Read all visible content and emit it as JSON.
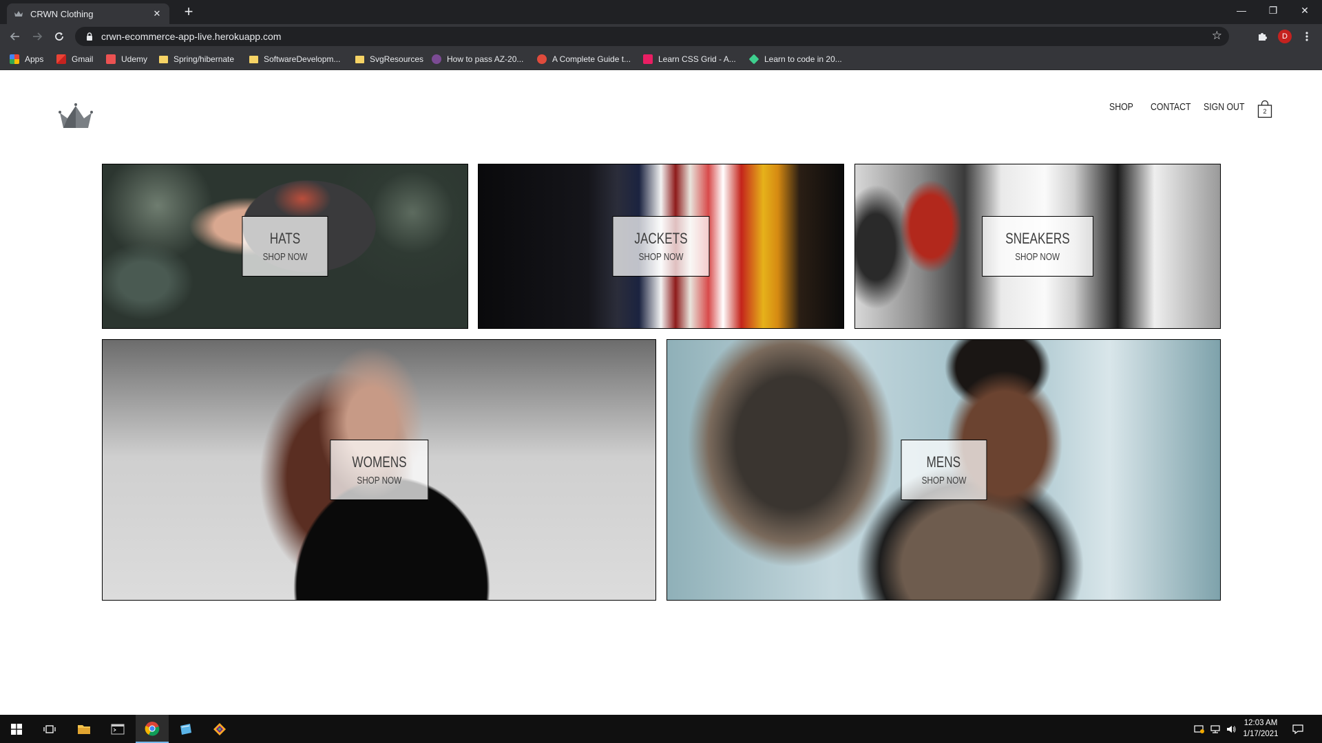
{
  "browser": {
    "tab_title": "CRWN Clothing",
    "tab_close": "✕",
    "new_tab": "+",
    "url": "crwn-ecommerce-app-live.herokuapp.com",
    "profile_initial": "D",
    "window_controls": {
      "minimize": "—",
      "restore": "❐",
      "close": "✕"
    },
    "bookmarks": [
      {
        "label": "Apps",
        "icon": "apps-grid-icon"
      },
      {
        "label": "Gmail",
        "icon": "gmail-icon"
      },
      {
        "label": "Udemy",
        "icon": "udemy-icon"
      },
      {
        "label": "Spring/hibernate",
        "icon": "folder-icon"
      },
      {
        "label": "SoftwareDevelopm...",
        "icon": "folder-icon"
      },
      {
        "label": "SvgResources",
        "icon": "folder-icon"
      },
      {
        "label": "How to pass AZ-20...",
        "icon": "site-icon"
      },
      {
        "label": "A Complete Guide t...",
        "icon": "site-icon"
      },
      {
        "label": "Learn CSS Grid - A...",
        "icon": "site-icon"
      },
      {
        "label": "Learn to code in 20...",
        "icon": "site-icon"
      }
    ]
  },
  "header": {
    "nav": {
      "shop": "SHOP",
      "contact": "CONTACT",
      "sign_out": "SIGN OUT"
    },
    "cart_count": "2"
  },
  "directory": [
    {
      "title": "HATS",
      "subtitle": "SHOP NOW"
    },
    {
      "title": "JACKETS",
      "subtitle": "SHOP NOW"
    },
    {
      "title": "SNEAKERS",
      "subtitle": "SHOP NOW"
    },
    {
      "title": "WOMENS",
      "subtitle": "SHOP NOW"
    },
    {
      "title": "MENS",
      "subtitle": "SHOP NOW"
    }
  ],
  "taskbar": {
    "time": "12:03 AM",
    "date": "1/17/2021"
  },
  "colors": {
    "accent_taskbar": "#76b9ed",
    "browser_dark": "#202124",
    "browser_toolbar": "#35363a"
  }
}
